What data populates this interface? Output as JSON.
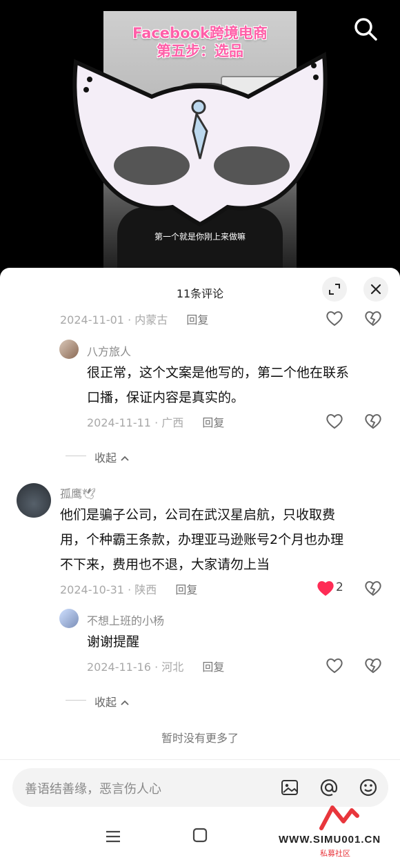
{
  "video": {
    "title_line1": "Facebook跨境电商",
    "title_line2": "第五步：选品",
    "subtitle": "第一个就是你刚上来做嘛"
  },
  "sheet": {
    "title": "11条评论"
  },
  "comments": [
    {
      "date": "2024-11-01",
      "region": "内蒙古",
      "reply_label": "回复"
    },
    {
      "name": "八方旅人",
      "text_line1": "很正常，这个文案是他写的，第二个他在联系",
      "text_line2": "口播，保证内容是真实的。",
      "date": "2024-11-11",
      "region": "广西",
      "reply_label": "回复"
    },
    {
      "name": "孤鹰🕊",
      "text_line1": "他们是骗子公司，公司在武汉星启航，只收取费",
      "text_line2": "用，个种霸王条款，办理亚马逊账号2个月也办理",
      "text_line3": "不下来，费用也不退，大家请勿上当",
      "date": "2024-10-31",
      "region": "陕西",
      "reply_label": "回复",
      "likes": "2"
    },
    {
      "name": "不想上班的小杨",
      "text": "谢谢提醒",
      "date": "2024-11-16",
      "region": "河北",
      "reply_label": "回复"
    }
  ],
  "collapse_label": "收起",
  "no_more": "暂时没有更多了",
  "input": {
    "placeholder": "善语结善缘，恶言伤人心"
  },
  "watermark": {
    "url": "WWW.SIMU001.CN",
    "sub": "私募社区"
  },
  "colors": {
    "accent_like": "#fe2c55",
    "brand_pink": "#ff5fa8"
  },
  "icons": [
    "search-icon",
    "expand-icon",
    "close-icon",
    "heart-icon",
    "broken-heart-icon",
    "image-icon",
    "at-icon",
    "emoji-icon",
    "menu-icon",
    "home-square-icon",
    "chevron-up-icon"
  ]
}
